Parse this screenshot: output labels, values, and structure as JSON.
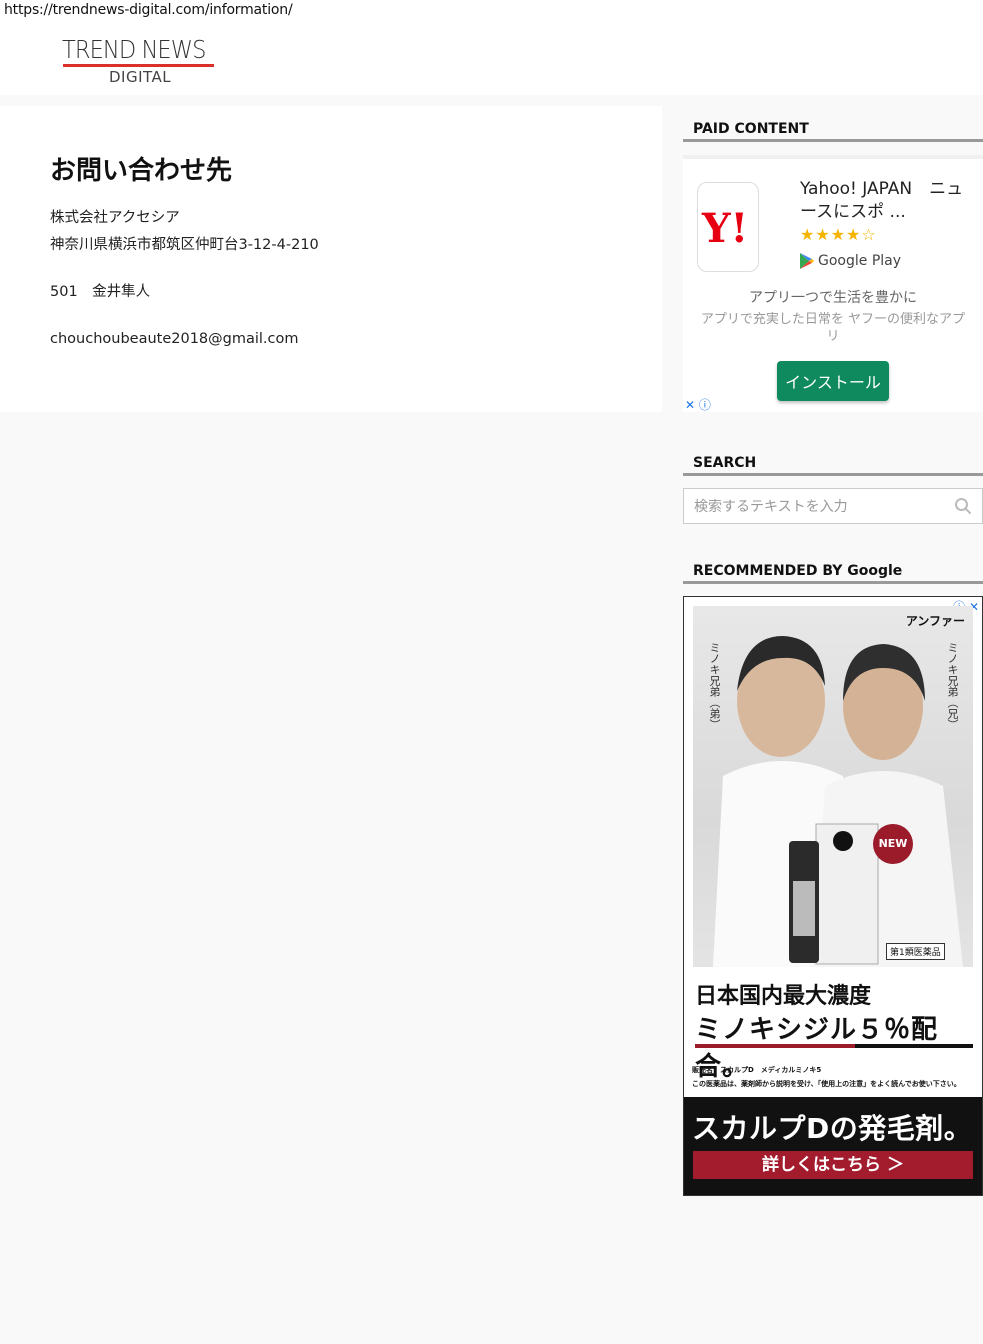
{
  "url": "https://trendnews-digital.com/information/",
  "logo": {
    "top": "TREND NEWS",
    "bottom": "DIGITAL"
  },
  "main": {
    "title": "お問い合わせ先",
    "company": "株式会社アクセシア",
    "address": "神奈川県横浜市都筑区仲町台3-12-4-210",
    "person": "501　金井隼人",
    "email": "chouchoubeaute2018@gmail.com"
  },
  "sidebar": {
    "paid_title": "PAID CONTENT",
    "search_title": "SEARCH",
    "recommended_title": "RECOMMENDED BY Google",
    "search_placeholder": "検索するテキストを入力"
  },
  "ad": {
    "app_name": "Yahoo! JAPAN　ニュースにスポ ...",
    "rating": "★★★★☆",
    "store": "Google Play",
    "headline": "アプリ一つで生活を豊かに",
    "description": "アプリで充実した日常を ヤフーの便利なアプリ",
    "install_label": "インストール",
    "adchoices": "✕ ⓘ",
    "icon_color": "#e60012",
    "button_color": "#0f8a5f"
  },
  "banner": {
    "icons": "ⓘ ✕",
    "brand": "アンファー",
    "left_caption": "ミノキ兄弟（弟）",
    "right_caption": "ミノキ兄弟（兄）",
    "new_badge": "NEW",
    "drug_label": "第1類医薬品",
    "headline1": "日本国内最大濃度",
    "headline2": "ミノキシジル５％配合。",
    "fine1": "販売名：スカルプD　メディカルミノキ5",
    "fine2": "この医薬品は、薬剤師から説明を受け、「使用上の注意」をよく読んでお使い下さい。",
    "bottom_head": "スカルプDの発毛剤。",
    "cta": "詳しくはこちら ＞",
    "accent_color": "#a31c2e"
  }
}
